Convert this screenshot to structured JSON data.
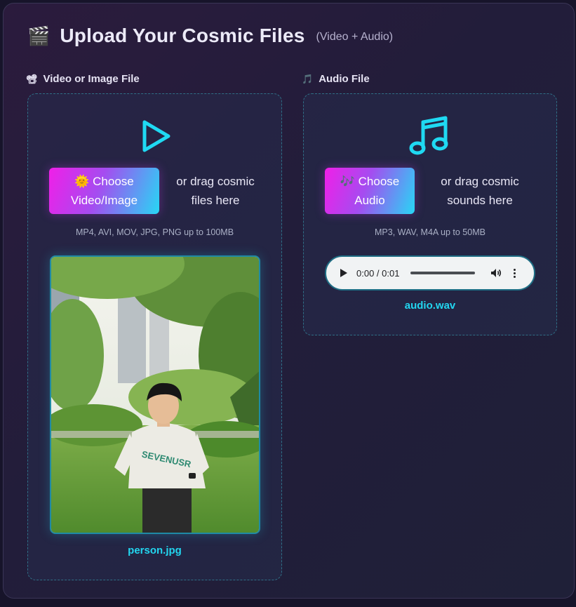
{
  "header": {
    "icon": "clapperboard-icon",
    "title": "Upload Your Cosmic Files",
    "subtitle": "(Video + Audio)"
  },
  "video": {
    "label_icon": "film-projector-icon",
    "label": "Video or Image File",
    "button_icon": "sun-icon",
    "button_line1": "Choose",
    "button_line2": "Video/Image",
    "drag_line1": "or drag cosmic",
    "drag_line2": "files here",
    "hint": "MP4, AVI, MOV, JPG, PNG up to 100MB",
    "filename": "person.jpg",
    "preview_shirt_text": "SEVENUSR"
  },
  "audio": {
    "label_icon": "music-note-icon",
    "label": "Audio File",
    "button_icon": "music-notes-icon",
    "button_line1": "Choose",
    "button_line2": "Audio",
    "drag_line1": "or drag cosmic",
    "drag_line2": "sounds here",
    "hint": "MP3, WAV, M4A up to 50MB",
    "player_time": "0:00 / 0:01",
    "filename": "audio.wav"
  },
  "colors": {
    "accent_cyan": "#22d6f0",
    "accent_magenta": "#f01fe8",
    "panel_bg": "#221d3a"
  }
}
